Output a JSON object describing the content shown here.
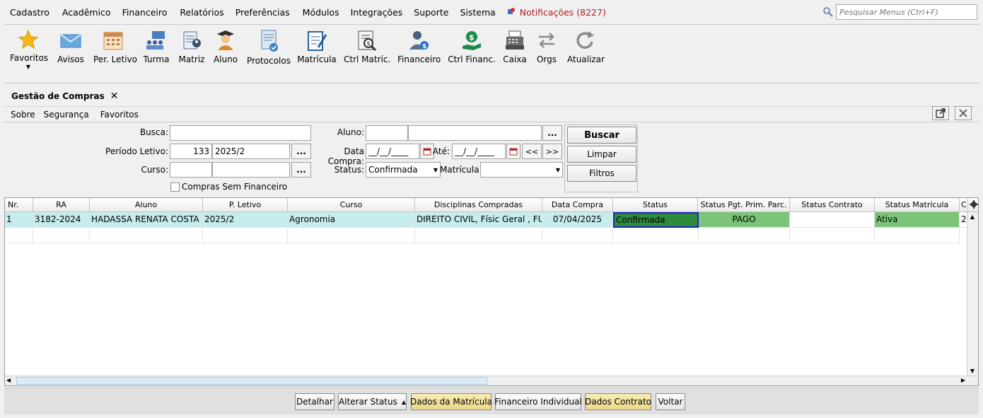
{
  "menu": {
    "items": [
      "Cadastro",
      "Acadêmico",
      "Financeiro",
      "Relatórios",
      "Preferências",
      "Módulos",
      "Integrações",
      "Suporte",
      "Sistema"
    ],
    "notifications": "Notificações (8227)",
    "search_placeholder": "Pesquisar Menus (Ctrl+F)"
  },
  "toolbar": {
    "favoritos": "Favoritos",
    "avisos": "Avisos",
    "per_letivo": "Per. Letivo",
    "turma": "Turma",
    "matriz": "Matriz",
    "aluno": "Aluno",
    "protocolos": "Protocolos",
    "matricula": "Matrícula",
    "ctrl_matric": "Ctrl Matríc.",
    "financeiro": "Financeiro",
    "ctrl_financ": "Ctrl Financ.",
    "caixa": "Caixa",
    "orgs": "Orgs",
    "atualizar": "Atualizar"
  },
  "tab": {
    "title": "Gestão de Compras",
    "close": "✕"
  },
  "submenu": {
    "sobre": "Sobre",
    "seguranca": "Segurança",
    "favoritos": "Favoritos"
  },
  "filters": {
    "busca_label": "Busca:",
    "busca_value": "",
    "periodo_label": "Período Letivo:",
    "periodo_code": "133",
    "periodo_value": "2025/2",
    "curso_label": "Curso:",
    "curso_code": "",
    "curso_value": "",
    "sem_financeiro_label": "Compras Sem Financeiro",
    "aluno_label": "Aluno:",
    "aluno_code": "",
    "aluno_value": "",
    "data_compra_label": "Data Compra:",
    "data_compra_value": "__/__/____",
    "ate_label": "Até:",
    "ate_value": "__/__/____",
    "status_label": "Status:",
    "status_value": "Confirmada",
    "matricula_label": "Matrícula:",
    "matricula_value": "",
    "dots": "...",
    "prev": "<<",
    "next": ">>"
  },
  "actions": {
    "buscar": "Buscar",
    "limpar": "Limpar",
    "filtros": "Filtros"
  },
  "grid": {
    "headers": [
      "Nr.",
      "RA",
      "Aluno",
      "P. Letivo",
      "Curso",
      "Disciplinas Compradas",
      "Data Compra",
      "Status",
      "Status Pgt. Prim. Parc.",
      "Status Contrato",
      "Status Matrícula",
      "C"
    ],
    "rows": [
      {
        "nr": "1",
        "ra": "3182-2024",
        "aluno": "HADASSA RENATA COSTA",
        "p_letivo": "2025/2",
        "curso": "Agronomia",
        "disciplinas": "DIREITO CIVIL, Físic Geral , FUN...",
        "data_compra": "07/04/2025",
        "status": "Confirmada",
        "status_pgt": "PAGO",
        "status_contrato": "",
        "status_matricula": "Ativa",
        "c": "2"
      }
    ]
  },
  "bottom": {
    "detalhar": "Detalhar",
    "alterar_status": "Alterar Status",
    "dados_matricula": "Dados da Matrícula",
    "financeiro_individual": "Financeiro Individual",
    "dados_contrato": "Dados Contrato",
    "voltar": "Voltar"
  },
  "colors": {
    "row_highlight": "#c6ecec",
    "status_confirmada": "#2e8b3e",
    "status_green": "#7cc47a",
    "selection_border": "#1a22c8",
    "notification": "#b02020",
    "yellow_button": "#f0dc94"
  }
}
